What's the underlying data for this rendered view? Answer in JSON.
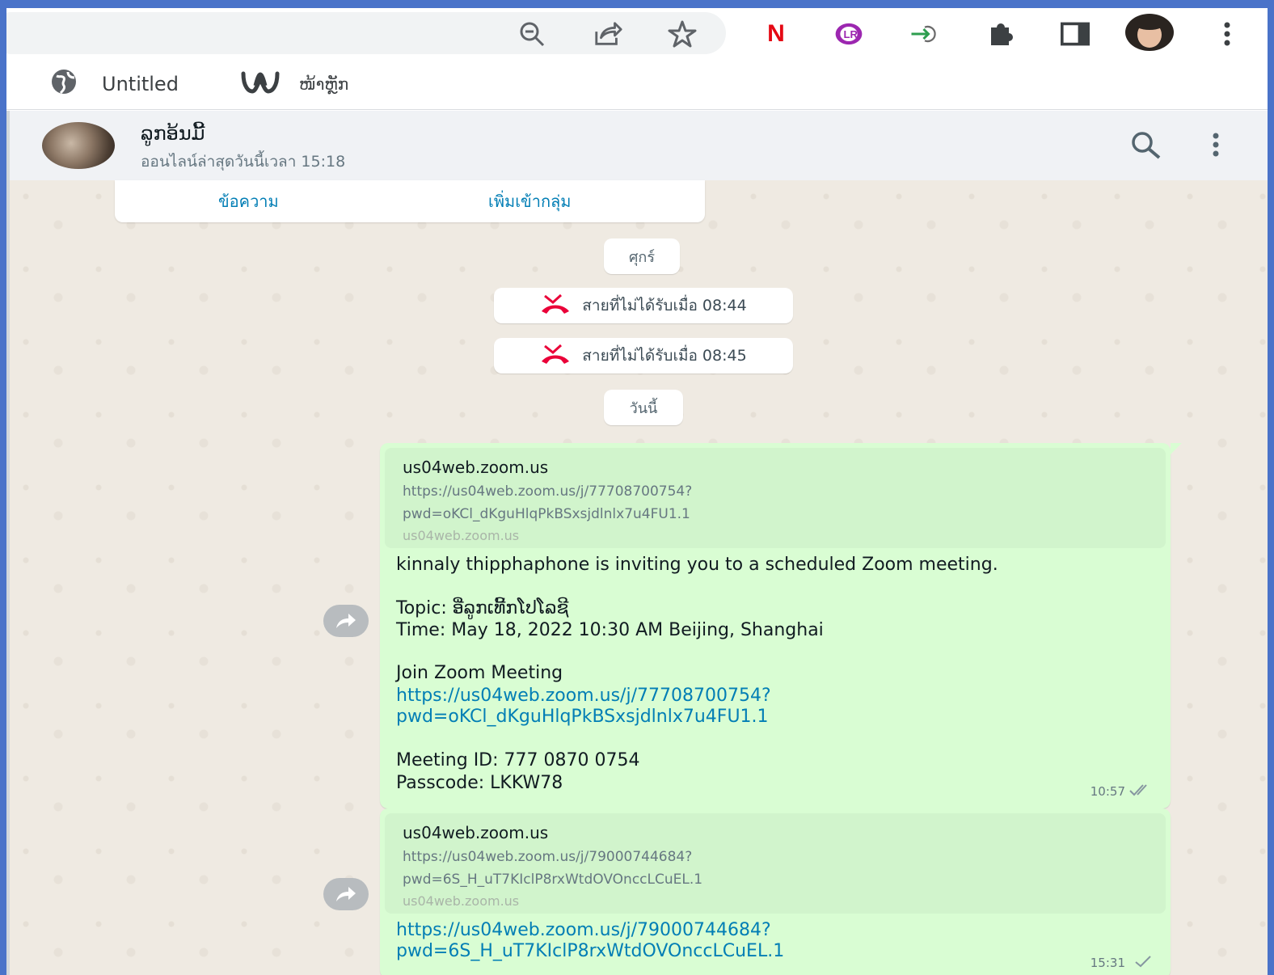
{
  "browser": {
    "toolbar_icons": [
      "zoom-out-icon",
      "share-icon",
      "bookmark-star-icon",
      "netflix-extension-icon",
      "language-reactor-extension-icon",
      "login-arrow-extension-icon",
      "extensions-puzzle-icon",
      "side-panel-icon",
      "profile-avatar",
      "menu-kebab-icon"
    ],
    "extension_letter": "N",
    "bookmarks": [
      {
        "label": "Untitled",
        "icon": "globe-icon"
      },
      {
        "label": "ໜ້າຫຼັກ",
        "icon": "weebly-w-icon"
      }
    ]
  },
  "chat_header": {
    "contact_name": "ລູກອ້ນມີ້",
    "last_seen": "ออนไลน์ล่าสุดวันนี้เวลา 15:18"
  },
  "actions": {
    "message": "ข้อความ",
    "add_to_group": "เพิ่มเข้ากลุ่ม"
  },
  "dividers": {
    "friday": "ศุกร์",
    "today": "วันนี้"
  },
  "missed_calls": [
    {
      "text": "สายที่ไม่ได้รับเมื่อ 08:44"
    },
    {
      "text": "สายที่ไม่ได้รับเมื่อ 08:45"
    }
  ],
  "messages": [
    {
      "preview": {
        "site": "us04web.zoom.us",
        "url_line1": "https://us04web.zoom.us/j/77708700754?",
        "url_line2": "pwd=oKCl_dKguHlqPkBSxsjdlnlx7u4FU1.1",
        "domain": "us04web.zoom.us"
      },
      "lines": {
        "invite": "kinnaly thipphaphone is inviting you to a scheduled Zoom meeting.",
        "topic": "Topic: ອີ່ລູກເທີ້ກໂປໂລຊີ",
        "time": "Time: May 18, 2022 10:30 AM Beijing, Shanghai",
        "join": "Join Zoom Meeting",
        "link1": "https://us04web.zoom.us/j/77708700754?",
        "link2": "pwd=oKCl_dKguHlqPkBSxsjdlnlx7u4FU1.1",
        "meeting_id": "Meeting ID: 777 0870 0754",
        "passcode": "Passcode: LKKW78"
      },
      "timestamp": "10:57",
      "status": "read-double-tick-icon"
    },
    {
      "preview": {
        "site": "us04web.zoom.us",
        "url_line1": "https://us04web.zoom.us/j/79000744684?",
        "url_line2": "pwd=6S_H_uT7KIclP8rxWtdOVOnccLCuEL.1",
        "domain": "us04web.zoom.us"
      },
      "lines": {
        "link1": "https://us04web.zoom.us/j/79000744684?",
        "link2": "pwd=6S_H_uT7KIclP8rxWtdOVOnccLCuEL.1"
      },
      "timestamp": "15:31",
      "status": "sent-single-tick-icon"
    }
  ],
  "colors": {
    "chat_bg": "#efeae2",
    "outgoing_bubble": "#d9fdd3",
    "link": "#027eb5",
    "missed_call_red": "#ea0038",
    "netflix_red": "#e50914",
    "extension_purple": "#9c27b0"
  }
}
